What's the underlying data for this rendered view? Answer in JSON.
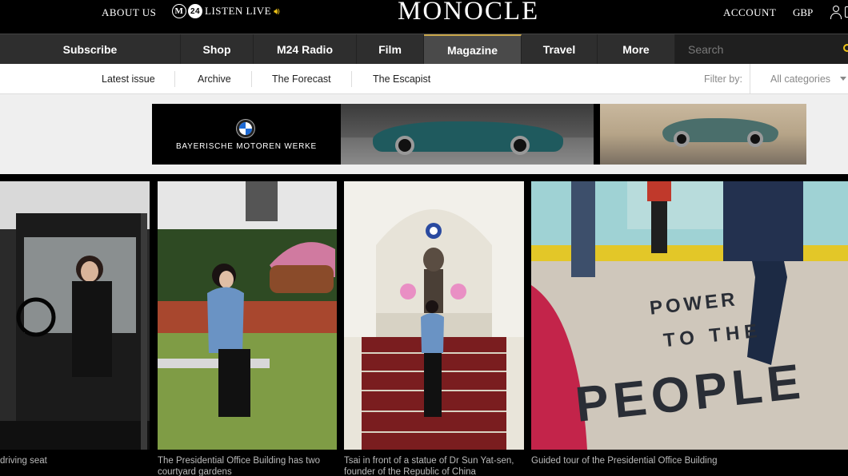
{
  "topbar": {
    "about": "ABOUT US",
    "listen_m": "M",
    "listen_badge": "24",
    "listen": "LISTEN LIVE",
    "logo": "MONOCLE",
    "account": "ACCOUNT",
    "currency": "GBP"
  },
  "nav": {
    "items": [
      {
        "label": "Subscribe"
      },
      {
        "label": "Shop"
      },
      {
        "label": "M24 Radio"
      },
      {
        "label": "Film"
      },
      {
        "label": "Magazine"
      },
      {
        "label": "Travel"
      },
      {
        "label": "More"
      }
    ],
    "active": "Magazine",
    "search_placeholder": "Search"
  },
  "subnav": {
    "items": [
      {
        "label": "Latest issue"
      },
      {
        "label": "Archive"
      },
      {
        "label": "The Forecast"
      },
      {
        "label": "The Escapist"
      }
    ],
    "filter_label": "Filter by:",
    "filter_value": "All categories"
  },
  "ad": {
    "brand_text": "BAYERISCHE MOTOREN WERKE"
  },
  "gallery": {
    "captions": [
      "driving seat",
      "The Presidential Office Building has two courtyard gardens",
      "Tsai in front of a statue of Dr Sun Yat-sen, founder of the Republic of China",
      "Guided tour of the Presidential Office Building"
    ],
    "floor_text": [
      "POWER",
      "TO THE",
      "PEOPLE"
    ]
  },
  "colors": {
    "accent": "#f0c419",
    "nav_bg": "#2e2e2e",
    "active_tab": "#4a4a4a"
  }
}
